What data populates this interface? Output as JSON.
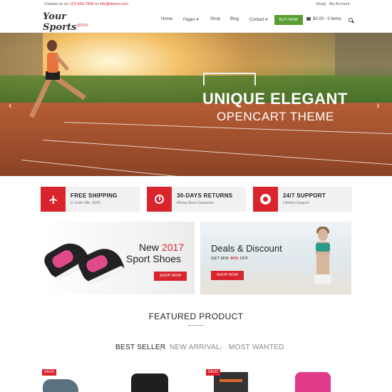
{
  "topbar": {
    "contact_prefix": "Contact us on",
    "phone": "123-456-7890",
    "or": "or",
    "email": "info@demo.com",
    "shop": "Shop",
    "my_account": "My Account"
  },
  "logo": {
    "line1": "Your Sports",
    "line2": "store"
  },
  "nav": {
    "home": "Home",
    "pages": "Pages ▾",
    "shop": "Shop",
    "blog": "Blog",
    "contact": "Contact ▾",
    "buy_now": "BUY NOW",
    "cart": "$0.00 - 0 items"
  },
  "hero": {
    "title": "UNIQUE ELEGANT",
    "subtitle": "OPENCART THEME",
    "prev": "‹",
    "next": "›"
  },
  "features": [
    {
      "title": "FREE SHIPPING",
      "subtitle": "In Order Min. $200",
      "icon": "airplane-icon"
    },
    {
      "title": "30-DAYS RETURNS",
      "subtitle": "Money Back Guarantee",
      "icon": "clock-icon"
    },
    {
      "title": "24/7 SUPPORT",
      "subtitle": "Lifetime Support",
      "icon": "lifebuoy-icon"
    }
  ],
  "banners": {
    "shoes": {
      "new": "New",
      "year": "2017",
      "line2": "Sport Shoes",
      "button": "SHOP NOW"
    },
    "deals": {
      "title": "Deals & Discount",
      "line_prefix": "GET MIN",
      "percent": "40%",
      "line_suffix": "OFF",
      "button": "SHOP NOW"
    }
  },
  "featured": {
    "title": "FEATURED PRODUCT",
    "tabs": [
      "BEST SELLER",
      "NEW ARRIVAL",
      "MOST WANTED"
    ],
    "sep": "/",
    "sale_label": "SALE!"
  },
  "colors": {
    "accent": "#d9232d",
    "buy_now": "#5a9e32",
    "feature_bg": "#f1f1f1"
  }
}
